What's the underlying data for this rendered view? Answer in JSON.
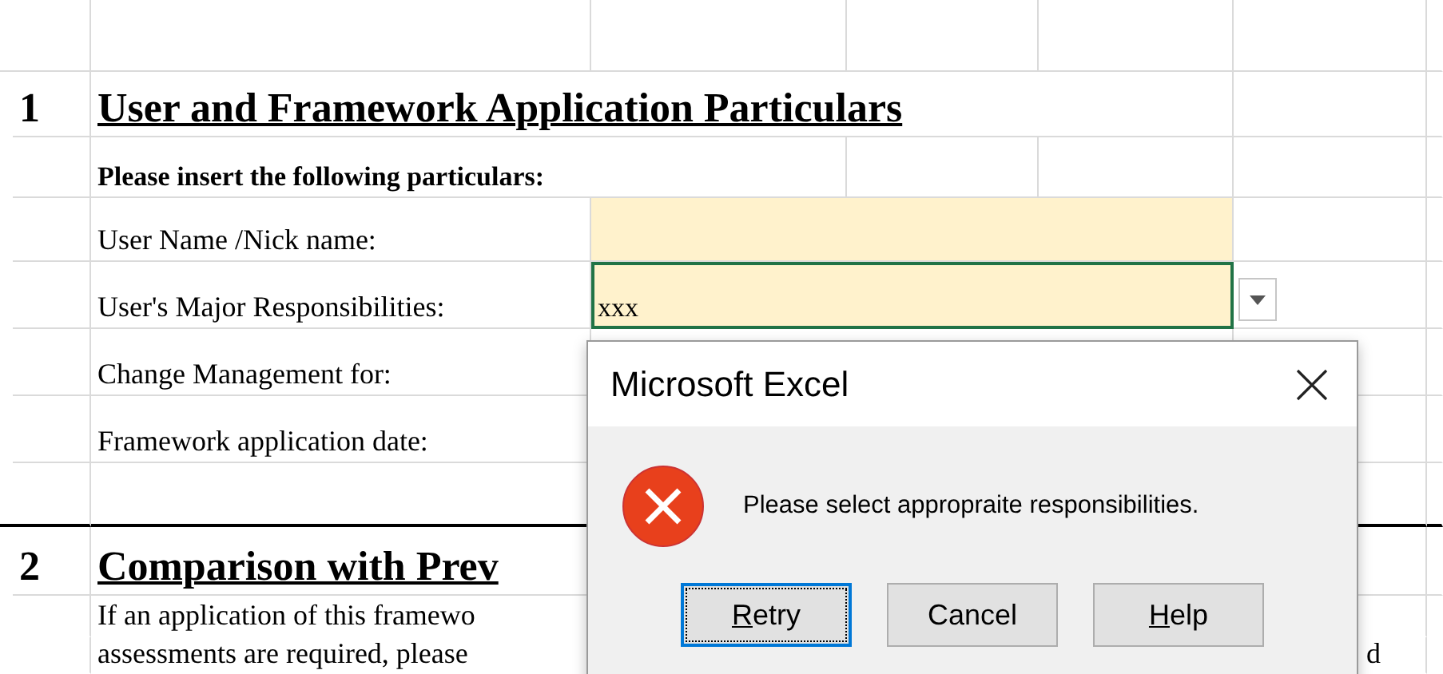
{
  "sections": [
    {
      "number": "1",
      "title": "User and Framework Application Particulars",
      "subtitle": "Please insert the following particulars:",
      "fields": [
        {
          "label": "User Name /Nick name:",
          "highlighted": true,
          "selected": false
        },
        {
          "label": "User's Major Responsibilities:",
          "value": "xxx",
          "highlighted": true,
          "selected": true,
          "dropdown": true
        },
        {
          "label": "Change Management for:"
        },
        {
          "label": "Framework application date:"
        }
      ]
    },
    {
      "number": "2",
      "title": "Comparison with Prev",
      "paragraph": [
        "If an application of this framewo",
        "assessments are required, please"
      ],
      "paragraph_tail": "d"
    }
  ],
  "dialog": {
    "title": "Microsoft Excel",
    "message": "Please select appropraite responsibilities.",
    "buttons": [
      {
        "label": "Retry",
        "access_key": true,
        "focused": true
      },
      {
        "label": "Cancel",
        "access_key": false,
        "focused": false
      },
      {
        "label": "Help",
        "access_key": true,
        "focused": false
      }
    ]
  }
}
